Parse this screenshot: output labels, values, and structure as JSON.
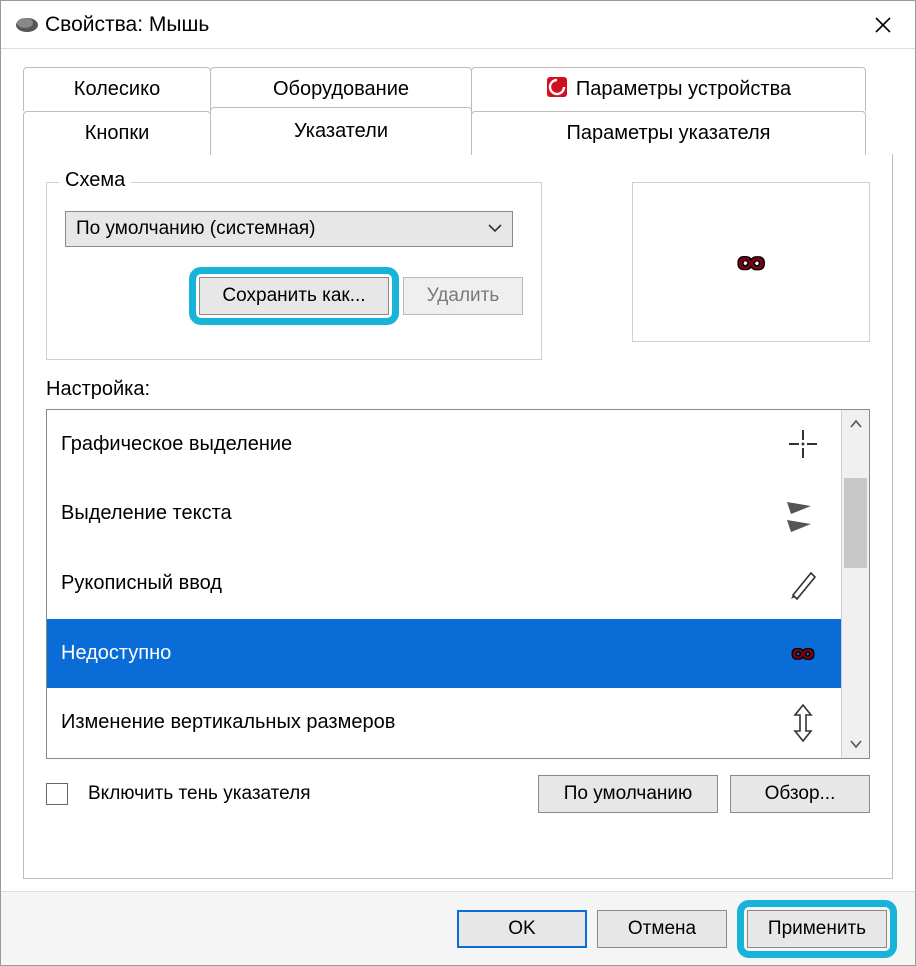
{
  "title": "Свойства: Мышь",
  "tabs_row1": [
    {
      "label": "Колесико"
    },
    {
      "label": "Оборудование"
    },
    {
      "label": "Параметры устройства",
      "icon": "device-red-icon"
    }
  ],
  "tabs_row2": [
    {
      "label": "Кнопки"
    },
    {
      "label": "Указатели",
      "active": true
    },
    {
      "label": "Параметры указателя"
    }
  ],
  "scheme": {
    "group_label": "Схема",
    "selected": "По умолчанию (системная)",
    "save_as": "Сохранить как...",
    "delete": "Удалить"
  },
  "settings_label": "Настройка:",
  "cursor_list": [
    {
      "name": "Графическое выделение",
      "icon": "precision-cross"
    },
    {
      "name": "Выделение текста",
      "icon": "text-select-arrows"
    },
    {
      "name": "Рукописный ввод",
      "icon": "pen"
    },
    {
      "name": "Недоступно",
      "icon": "unavailable-infinity",
      "selected": true
    },
    {
      "name": "Изменение вертикальных размеров",
      "icon": "resize-vert"
    }
  ],
  "shadow_checkbox": "Включить тень указателя",
  "defaults_btn": "По умолчанию",
  "browse_btn": "Обзор...",
  "dialog_buttons": {
    "ok": "OK",
    "cancel": "Отмена",
    "apply": "Применить"
  },
  "preview_icon": "unavailable-infinity"
}
